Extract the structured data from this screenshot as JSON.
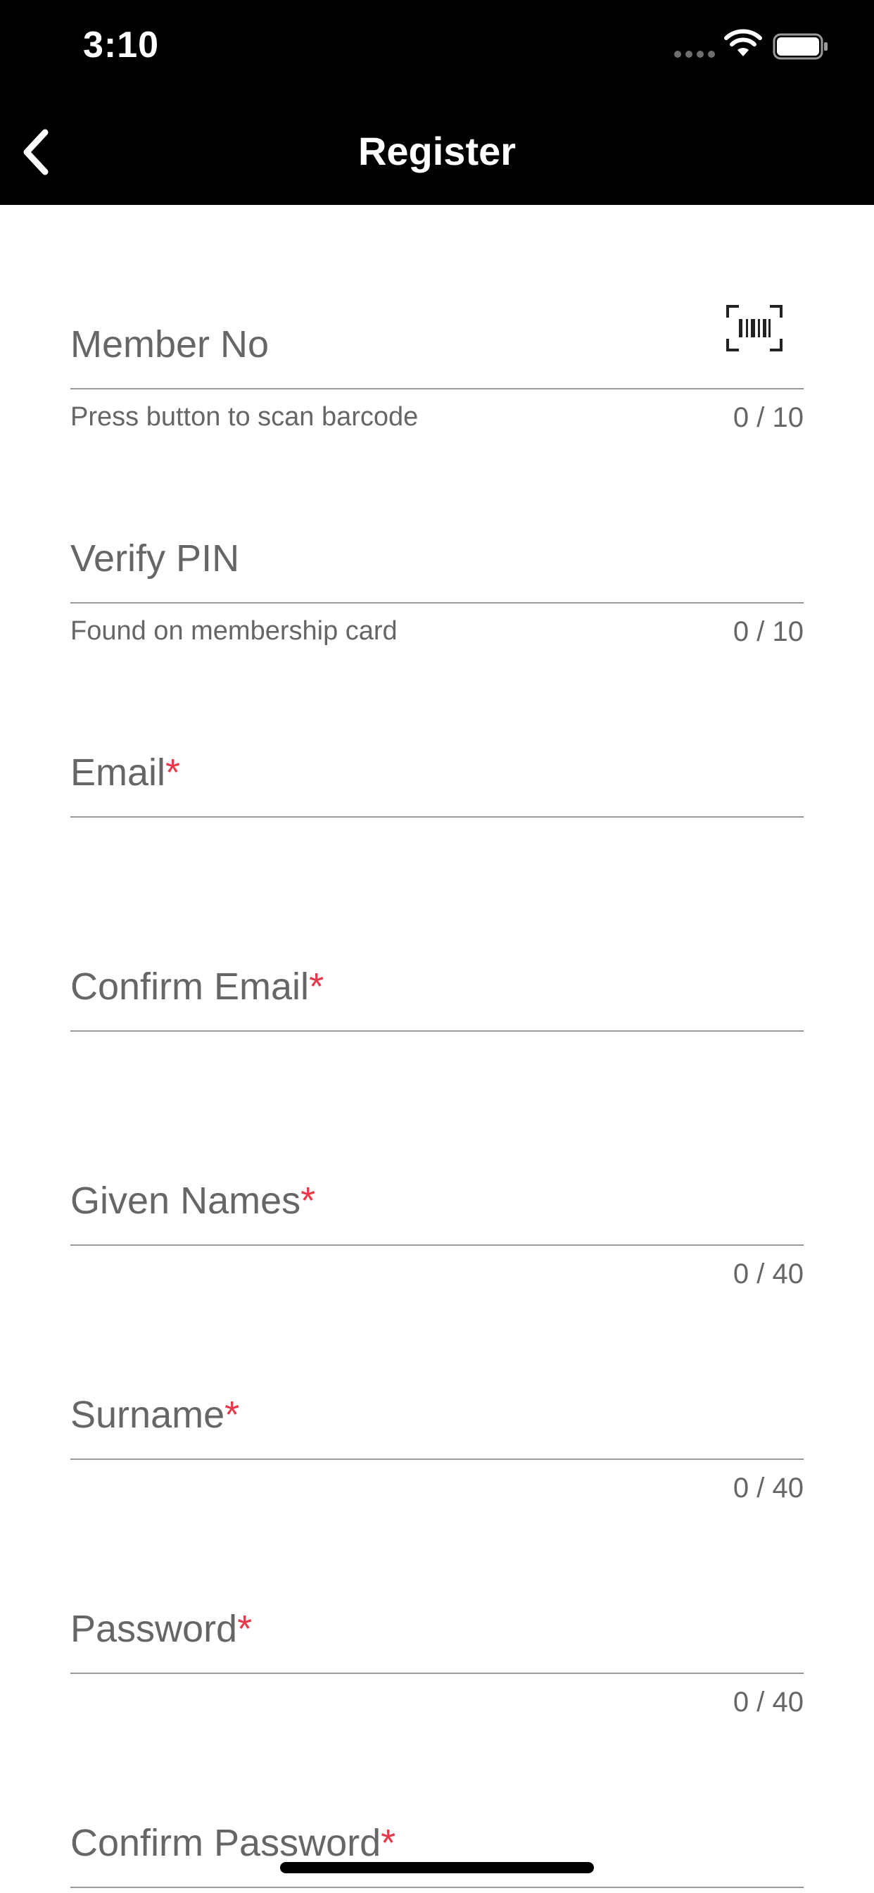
{
  "status_bar": {
    "time": "3:10"
  },
  "header": {
    "title": "Register"
  },
  "form": {
    "member_no": {
      "label": "Member No",
      "hint": "Press button to scan barcode",
      "counter": "0 / 10"
    },
    "verify_pin": {
      "label": "Verify PIN",
      "hint": "Found on membership card",
      "counter": "0 / 10"
    },
    "email": {
      "label": "Email",
      "required_mark": "*"
    },
    "confirm_email": {
      "label": "Confirm Email",
      "required_mark": "*"
    },
    "given_names": {
      "label": "Given Names",
      "required_mark": "*",
      "counter": "0 / 40"
    },
    "surname": {
      "label": "Surname",
      "required_mark": "*",
      "counter": "0 / 40"
    },
    "password": {
      "label": "Password",
      "required_mark": "*",
      "counter": "0 / 40"
    },
    "confirm_password": {
      "label": "Confirm Password",
      "required_mark": "*"
    }
  },
  "icons": {
    "back": "chevron-left-icon",
    "scan": "barcode-scan-icon",
    "wifi": "wifi-icon",
    "battery": "battery-icon"
  },
  "colors": {
    "header_background": "#000000",
    "required_mark": "#e8384b",
    "label_text": "#666666",
    "underline": "#999999"
  }
}
